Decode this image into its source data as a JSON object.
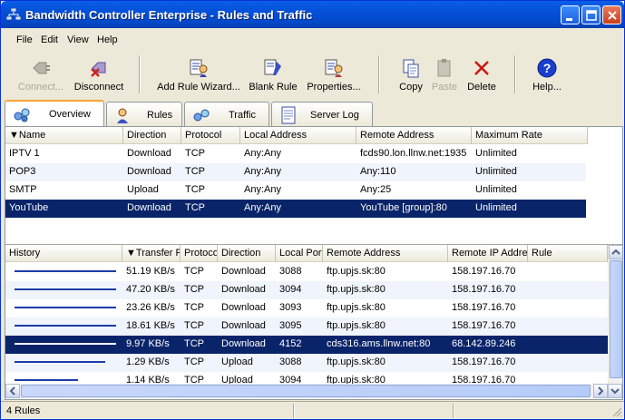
{
  "window": {
    "title": "Bandwidth Controller Enterprise - Rules and Traffic"
  },
  "menu": [
    "File",
    "Edit",
    "View",
    "Help"
  ],
  "toolbar": {
    "connect": "Connect...",
    "disconnect": "Disconnect",
    "add_rule_wizard": "Add Rule Wizard...",
    "blank_rule": "Blank Rule",
    "properties": "Properties...",
    "copy": "Copy",
    "paste": "Paste",
    "delete": "Delete",
    "help": "Help..."
  },
  "tabs": [
    "Overview",
    "Rules",
    "Traffic",
    "Server Log"
  ],
  "rules_table": {
    "columns": [
      "▼Name",
      "Direction",
      "Protocol",
      "Local Address",
      "Remote Address",
      "Maximum Rate"
    ],
    "rows": [
      [
        "IPTV 1",
        "Download",
        "TCP",
        "Any:Any",
        "fcds90.lon.llnw.net:1935",
        "Unlimited"
      ],
      [
        "POP3",
        "Download",
        "TCP",
        "Any:Any",
        "Any:110",
        "Unlimited"
      ],
      [
        "SMTP",
        "Upload",
        "TCP",
        "Any:Any",
        "Any:25",
        "Unlimited"
      ],
      [
        "YouTube",
        "Download",
        "TCP",
        "Any:Any",
        "YouTube [group]:80",
        "Unlimited"
      ]
    ]
  },
  "traffic_table": {
    "columns": [
      "History",
      "▼Transfer R",
      "Protoco",
      "Direction",
      "Local Port",
      "Remote Address",
      "Remote IP Addres",
      "Rule"
    ],
    "rows": [
      [
        "51.19 KB/s",
        "TCP",
        "Download",
        "3088",
        "ftp.upjs.sk:80",
        "158.197.16.70",
        ""
      ],
      [
        "47.20 KB/s",
        "TCP",
        "Download",
        "3094",
        "ftp.upjs.sk:80",
        "158.197.16.70",
        ""
      ],
      [
        "23.26 KB/s",
        "TCP",
        "Download",
        "3093",
        "ftp.upjs.sk:80",
        "158.197.16.70",
        ""
      ],
      [
        "18.61 KB/s",
        "TCP",
        "Download",
        "3095",
        "ftp.upjs.sk:80",
        "158.197.16.70",
        ""
      ],
      [
        "9.97 KB/s",
        "TCP",
        "Download",
        "4152",
        "cds316.ams.llnw.net:80",
        "68.142.89.246",
        ""
      ],
      [
        "1.29 KB/s",
        "TCP",
        "Upload",
        "3088",
        "ftp.upjs.sk:80",
        "158.197.16.70",
        ""
      ],
      [
        "1.14 KB/s",
        "TCP",
        "Upload",
        "3094",
        "ftp.upjs.sk:80",
        "158.197.16.70",
        ""
      ]
    ]
  },
  "status": {
    "text": "4 Rules"
  },
  "colors": {
    "selection": "#0a246a",
    "title_blue": "#0450d8",
    "history_line": "#1c3ca8"
  }
}
